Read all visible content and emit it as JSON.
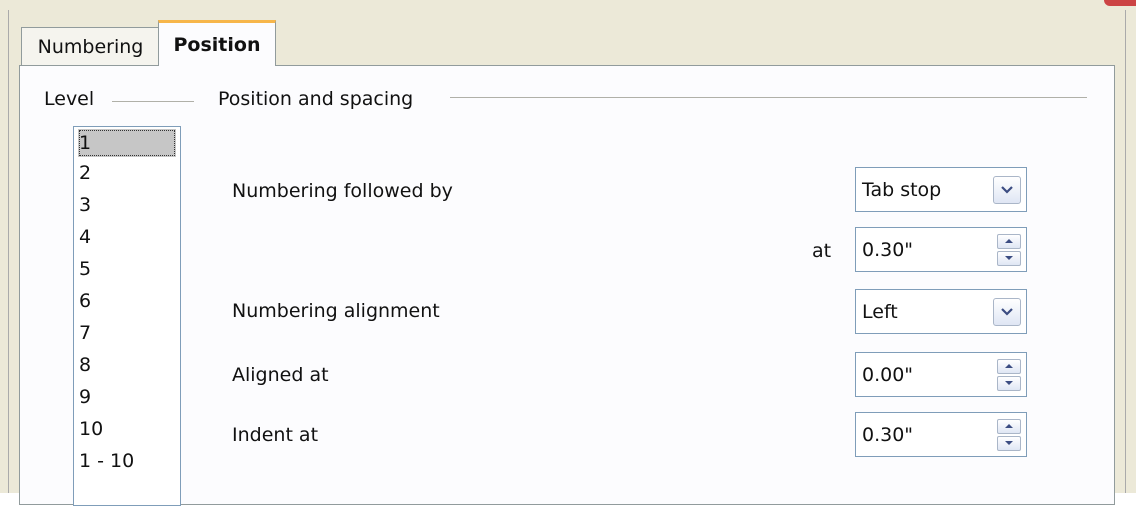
{
  "tabs": [
    {
      "label": "Numbering",
      "active": false
    },
    {
      "label": "Position",
      "active": true
    }
  ],
  "level": {
    "label": "Level",
    "items": [
      "1",
      "2",
      "3",
      "4",
      "5",
      "6",
      "7",
      "8",
      "9",
      "10",
      "1 - 10"
    ],
    "selected": "1"
  },
  "position_spacing": {
    "section_label": "Position and spacing",
    "followed_by": {
      "label": "Numbering followed by",
      "value": "Tab stop"
    },
    "at": {
      "label": "at",
      "value": "0.30\""
    },
    "alignment": {
      "label": "Numbering alignment",
      "value": "Left"
    },
    "aligned_at": {
      "label": "Aligned at",
      "value": "0.00\""
    },
    "indent_at": {
      "label": "Indent at",
      "value": "0.30\""
    }
  },
  "colors": {
    "active_tab_accent": "#f7b64a",
    "selection": "#c6c6c6",
    "field_border": "#7f9db9"
  }
}
